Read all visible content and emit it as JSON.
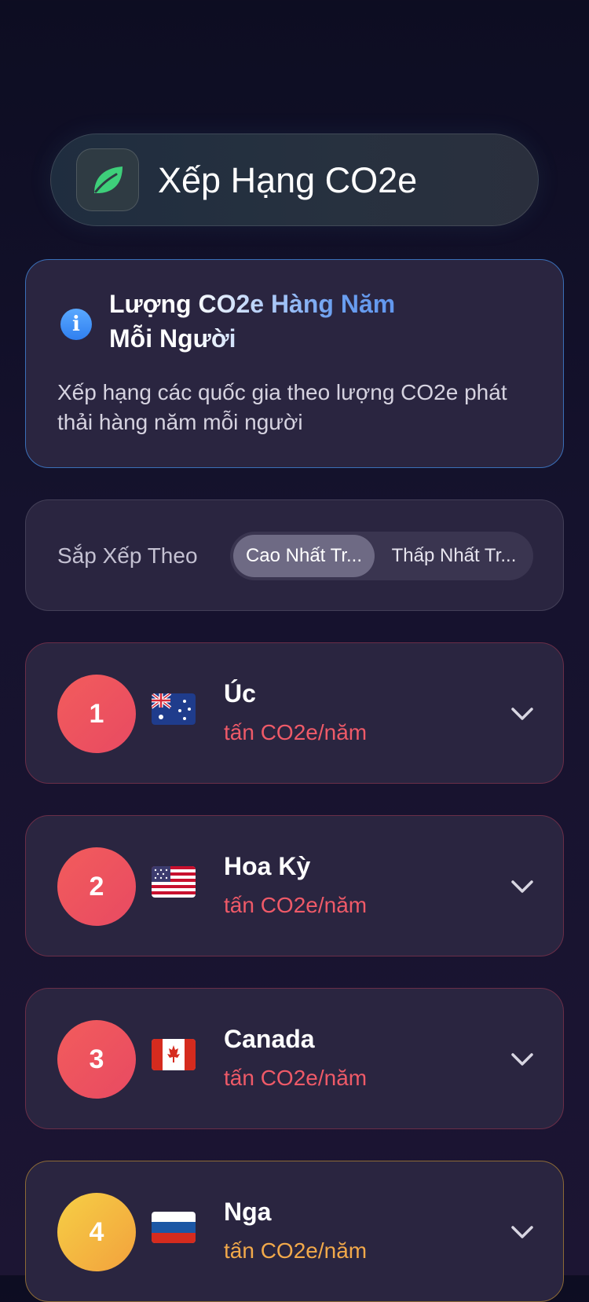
{
  "header": {
    "title": "Xếp Hạng CO2e",
    "icon": "leaf-icon"
  },
  "info": {
    "icon": "info-icon",
    "title_line1": "Lượng CO2e Hàng Năm",
    "title_line2": "Mỗi Người",
    "description": "Xếp hạng các quốc gia theo lượng CO2e phát thải hàng năm mỗi người"
  },
  "sort": {
    "label": "Sắp Xếp Theo",
    "options": [
      {
        "label": "Cao Nhất Tr...",
        "selected": true
      },
      {
        "label": "Thấp Nhất Tr...",
        "selected": false
      }
    ]
  },
  "rankings": [
    {
      "rank": "1",
      "flag": "australia-flag-icon",
      "country": "Úc",
      "unit": "tấn CO2e/năm",
      "color": "#ef5a68"
    },
    {
      "rank": "2",
      "flag": "usa-flag-icon",
      "country": "Hoa Kỳ",
      "unit": "tấn CO2e/năm",
      "color": "#ef5a68"
    },
    {
      "rank": "3",
      "flag": "canada-flag-icon",
      "country": "Canada",
      "unit": "tấn CO2e/năm",
      "color": "#ef5a68"
    },
    {
      "rank": "4",
      "flag": "russia-flag-icon",
      "country": "Nga",
      "unit": "tấn CO2e/năm",
      "color": "#f2a94a"
    }
  ],
  "colors": {
    "accent_blue": "#4f86e6",
    "rank_red": "#ef5a68",
    "rank_amber": "#f2a94a",
    "leaf_green": "#3ecf7a"
  }
}
